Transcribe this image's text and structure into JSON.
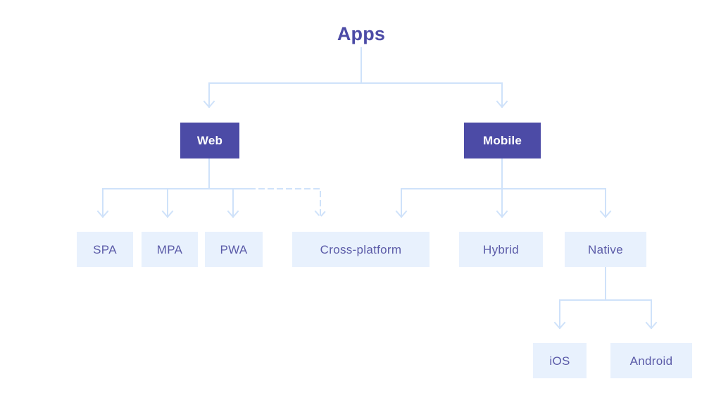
{
  "diagram": {
    "type": "hierarchy-tree",
    "title": "Apps",
    "background_color": "#ffffff",
    "colors": {
      "title_text": "#4c4ba6",
      "primary_node_bg": "#4c4ba6",
      "primary_node_text": "#ffffff",
      "leaf_node_bg": "#e8f1fd",
      "leaf_node_text": "#5b5ba8",
      "connector": "#cfe2fa"
    },
    "nodes": {
      "root": {
        "label": "Apps",
        "level": 0
      },
      "web": {
        "label": "Web",
        "level": 1
      },
      "mobile": {
        "label": "Mobile",
        "level": 1
      },
      "spa": {
        "label": "SPA",
        "level": 2
      },
      "mpa": {
        "label": "MPA",
        "level": 2
      },
      "pwa": {
        "label": "PWA",
        "level": 2
      },
      "cross_platform": {
        "label": "Cross-platform",
        "level": 2
      },
      "hybrid": {
        "label": "Hybrid",
        "level": 2
      },
      "native": {
        "label": "Native",
        "level": 2
      },
      "ios": {
        "label": "iOS",
        "level": 3
      },
      "android": {
        "label": "Android",
        "level": 3
      }
    },
    "edges": [
      {
        "from": "root",
        "to": "web",
        "style": "solid"
      },
      {
        "from": "root",
        "to": "mobile",
        "style": "solid"
      },
      {
        "from": "web",
        "to": "spa",
        "style": "solid"
      },
      {
        "from": "web",
        "to": "mpa",
        "style": "solid"
      },
      {
        "from": "web",
        "to": "pwa",
        "style": "solid"
      },
      {
        "from": "web",
        "to": "cross_platform",
        "style": "dashed"
      },
      {
        "from": "mobile",
        "to": "hybrid",
        "style": "solid"
      },
      {
        "from": "mobile",
        "to": "native",
        "style": "solid"
      },
      {
        "from": "mobile",
        "to": "cross_platform",
        "style": "solid"
      },
      {
        "from": "native",
        "to": "ios",
        "style": "solid"
      },
      {
        "from": "native",
        "to": "android",
        "style": "solid"
      }
    ]
  }
}
